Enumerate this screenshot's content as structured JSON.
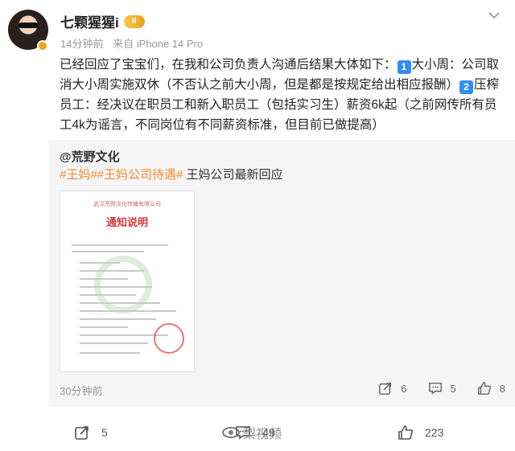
{
  "post": {
    "username": "七颗猩猩i",
    "vip_level": "II",
    "time": "14分钟前",
    "source": "来自 iPhone 14 Pro",
    "body_part1": "已经回应了宝宝们，在我和公司负责人沟通后结果大体如下：",
    "num1": "1",
    "body_part2": "大小周：公司取消大小周实施双休（不否认之前大小周，但是都是按规定给出相应报酬）",
    "num2": "2",
    "body_part3": "压榨员工：经决议在职员工和新入职员工（包括实习生）薪资6k起（之前网传所有员工4k为谣言，不同岗位有不同薪资标准，但目前已做提高）"
  },
  "repost": {
    "author": "@荒野文化",
    "hashtag1": "#王妈#",
    "hashtag2": "#王妈公司待遇#",
    "text": " 王妈公司最新回应",
    "notice": {
      "org": "武汉荒野文化传播有限公司",
      "title": "通知说明"
    },
    "time": "30分钟前",
    "reposts": "6",
    "comments": "5",
    "likes": "8"
  },
  "bottom": {
    "reposts": "5",
    "comments": "49",
    "likes": "223"
  },
  "watermark": "梨视频",
  "icons": [
    "more-icon",
    "repost-icon",
    "comment-icon",
    "like-icon"
  ],
  "colors": {
    "hashtag": "#f08b2a",
    "vip": "#e9a21c",
    "notice_title": "#d23b3b"
  }
}
